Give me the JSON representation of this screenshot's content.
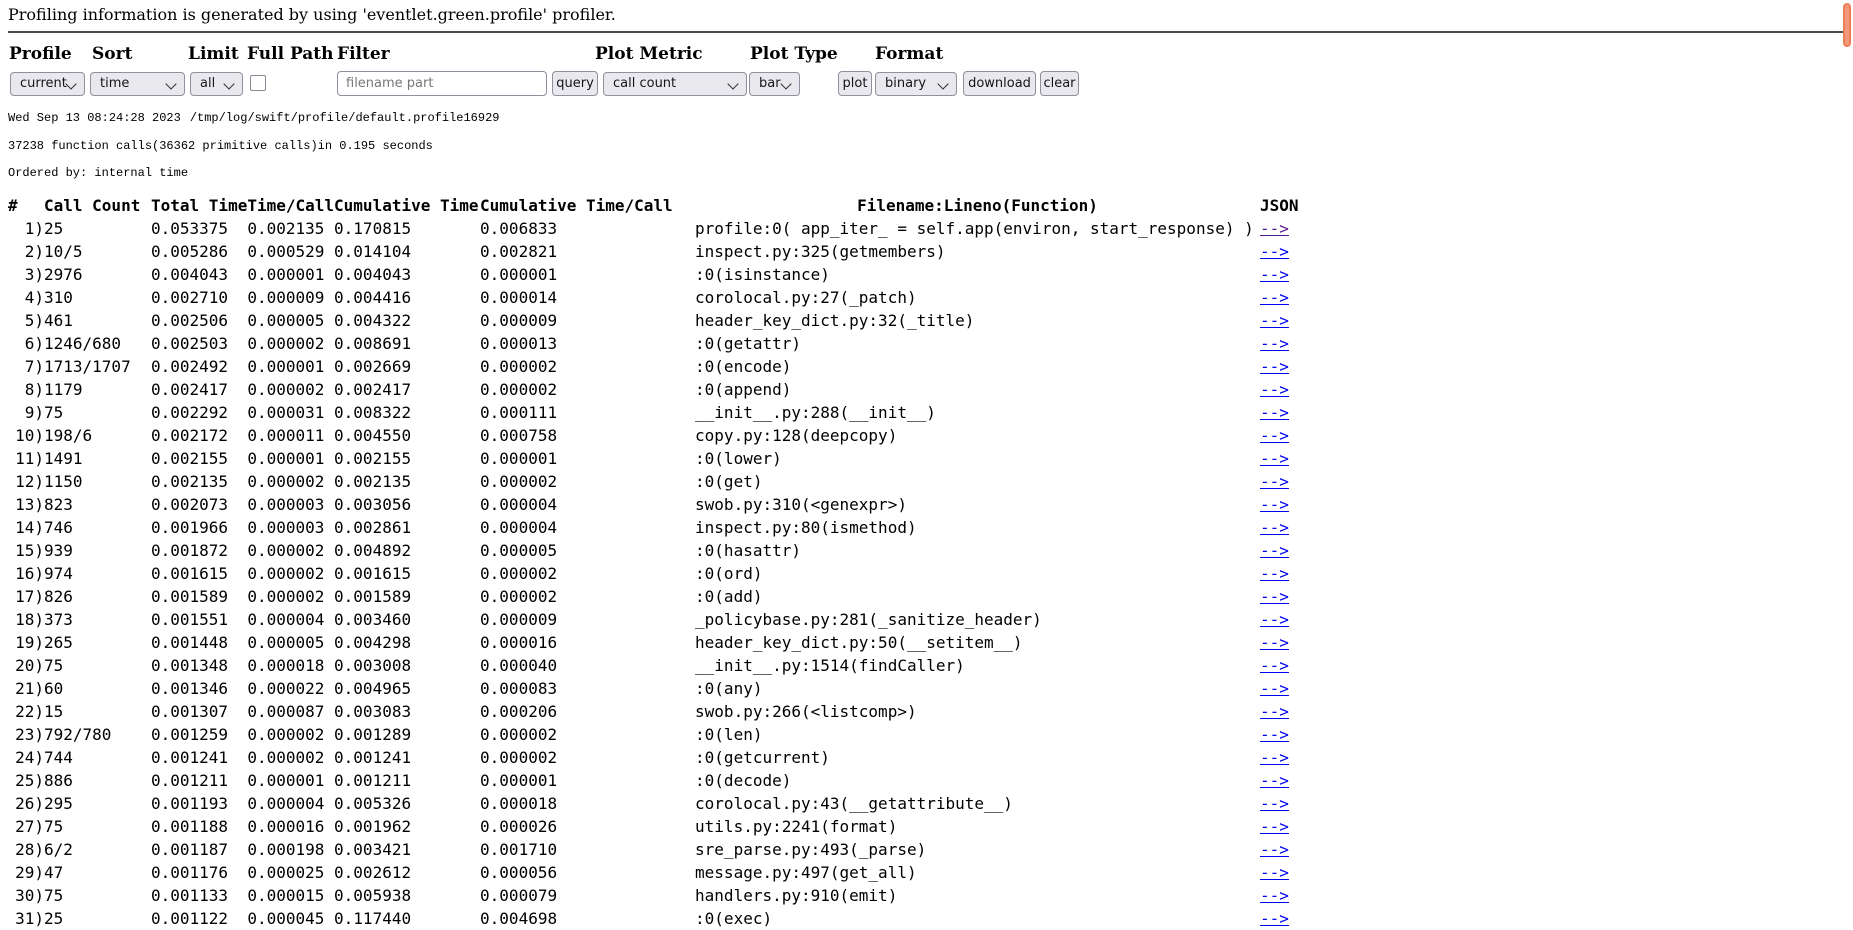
{
  "intro": "Profiling information is generated by using 'eventlet.green.profile' profiler.",
  "form": {
    "profile": {
      "label": "Profile",
      "value": "current"
    },
    "sort": {
      "label": "Sort",
      "value": "time"
    },
    "limit": {
      "label": "Limit",
      "value": "all"
    },
    "full_path": {
      "label": "Full Path",
      "checked": false
    },
    "filter": {
      "label": "Filter",
      "placeholder": "filename part",
      "value": ""
    },
    "plot_metric": {
      "label": "Plot Metric",
      "value": "call count"
    },
    "plot_type": {
      "label": "Plot Type",
      "value": "bar"
    },
    "format": {
      "label": "Format",
      "value": "binary"
    },
    "buttons": {
      "query": "query",
      "plot": "plot",
      "download": "download",
      "clear": "clear"
    }
  },
  "profile_info": {
    "timestamp": "Wed Sep 13 08:24:28 2023",
    "path": "/tmp/log/swift/profile/default.profile16929",
    "calls_summary": "37238 function calls(36362 primitive calls)in 0.195 seconds",
    "ordered_by": "Ordered by: internal time"
  },
  "table": {
    "headers": [
      "#",
      "Call Count",
      "Total Time",
      "Time/Call",
      "Cumulative Time",
      "Cumulative Time/Call",
      "Filename:Lineno(Function)",
      "JSON"
    ],
    "json_link_label": "-->",
    "rows": [
      {
        "n": "1)",
        "call_count": "25",
        "total_time": "0.053375",
        "time_per_call": "0.002135",
        "cum_time": "0.170815",
        "cum_time_per_call": "0.006833",
        "filename": "profile:0( app_iter_ = self.app(environ, start_response) )",
        "visited": true
      },
      {
        "n": "2)",
        "call_count": "10/5",
        "total_time": "0.005286",
        "time_per_call": "0.000529",
        "cum_time": "0.014104",
        "cum_time_per_call": "0.002821",
        "filename": "inspect.py:325(getmembers)",
        "visited": false
      },
      {
        "n": "3)",
        "call_count": "2976",
        "total_time": "0.004043",
        "time_per_call": "0.000001",
        "cum_time": "0.004043",
        "cum_time_per_call": "0.000001",
        "filename": ":0(isinstance)",
        "visited": false
      },
      {
        "n": "4)",
        "call_count": "310",
        "total_time": "0.002710",
        "time_per_call": "0.000009",
        "cum_time": "0.004416",
        "cum_time_per_call": "0.000014",
        "filename": "corolocal.py:27(_patch)",
        "visited": false
      },
      {
        "n": "5)",
        "call_count": "461",
        "total_time": "0.002506",
        "time_per_call": "0.000005",
        "cum_time": "0.004322",
        "cum_time_per_call": "0.000009",
        "filename": "header_key_dict.py:32(_title)",
        "visited": false
      },
      {
        "n": "6)",
        "call_count": "1246/680",
        "total_time": "0.002503",
        "time_per_call": "0.000002",
        "cum_time": "0.008691",
        "cum_time_per_call": "0.000013",
        "filename": ":0(getattr)",
        "visited": false
      },
      {
        "n": "7)",
        "call_count": "1713/1707",
        "total_time": "0.002492",
        "time_per_call": "0.000001",
        "cum_time": "0.002669",
        "cum_time_per_call": "0.000002",
        "filename": ":0(encode)",
        "visited": false
      },
      {
        "n": "8)",
        "call_count": "1179",
        "total_time": "0.002417",
        "time_per_call": "0.000002",
        "cum_time": "0.002417",
        "cum_time_per_call": "0.000002",
        "filename": ":0(append)",
        "visited": false
      },
      {
        "n": "9)",
        "call_count": "75",
        "total_time": "0.002292",
        "time_per_call": "0.000031",
        "cum_time": "0.008322",
        "cum_time_per_call": "0.000111",
        "filename": "__init__.py:288(__init__)",
        "visited": false
      },
      {
        "n": "10)",
        "call_count": "198/6",
        "total_time": "0.002172",
        "time_per_call": "0.000011",
        "cum_time": "0.004550",
        "cum_time_per_call": "0.000758",
        "filename": "copy.py:128(deepcopy)",
        "visited": false
      },
      {
        "n": "11)",
        "call_count": "1491",
        "total_time": "0.002155",
        "time_per_call": "0.000001",
        "cum_time": "0.002155",
        "cum_time_per_call": "0.000001",
        "filename": ":0(lower)",
        "visited": false
      },
      {
        "n": "12)",
        "call_count": "1150",
        "total_time": "0.002135",
        "time_per_call": "0.000002",
        "cum_time": "0.002135",
        "cum_time_per_call": "0.000002",
        "filename": ":0(get)",
        "visited": false
      },
      {
        "n": "13)",
        "call_count": "823",
        "total_time": "0.002073",
        "time_per_call": "0.000003",
        "cum_time": "0.003056",
        "cum_time_per_call": "0.000004",
        "filename": "swob.py:310(<genexpr>)",
        "visited": false
      },
      {
        "n": "14)",
        "call_count": "746",
        "total_time": "0.001966",
        "time_per_call": "0.000003",
        "cum_time": "0.002861",
        "cum_time_per_call": "0.000004",
        "filename": "inspect.py:80(ismethod)",
        "visited": false
      },
      {
        "n": "15)",
        "call_count": "939",
        "total_time": "0.001872",
        "time_per_call": "0.000002",
        "cum_time": "0.004892",
        "cum_time_per_call": "0.000005",
        "filename": ":0(hasattr)",
        "visited": false
      },
      {
        "n": "16)",
        "call_count": "974",
        "total_time": "0.001615",
        "time_per_call": "0.000002",
        "cum_time": "0.001615",
        "cum_time_per_call": "0.000002",
        "filename": ":0(ord)",
        "visited": false
      },
      {
        "n": "17)",
        "call_count": "826",
        "total_time": "0.001589",
        "time_per_call": "0.000002",
        "cum_time": "0.001589",
        "cum_time_per_call": "0.000002",
        "filename": ":0(add)",
        "visited": false
      },
      {
        "n": "18)",
        "call_count": "373",
        "total_time": "0.001551",
        "time_per_call": "0.000004",
        "cum_time": "0.003460",
        "cum_time_per_call": "0.000009",
        "filename": "_policybase.py:281(_sanitize_header)",
        "visited": false
      },
      {
        "n": "19)",
        "call_count": "265",
        "total_time": "0.001448",
        "time_per_call": "0.000005",
        "cum_time": "0.004298",
        "cum_time_per_call": "0.000016",
        "filename": "header_key_dict.py:50(__setitem__)",
        "visited": false
      },
      {
        "n": "20)",
        "call_count": "75",
        "total_time": "0.001348",
        "time_per_call": "0.000018",
        "cum_time": "0.003008",
        "cum_time_per_call": "0.000040",
        "filename": "__init__.py:1514(findCaller)",
        "visited": false
      },
      {
        "n": "21)",
        "call_count": "60",
        "total_time": "0.001346",
        "time_per_call": "0.000022",
        "cum_time": "0.004965",
        "cum_time_per_call": "0.000083",
        "filename": ":0(any)",
        "visited": false
      },
      {
        "n": "22)",
        "call_count": "15",
        "total_time": "0.001307",
        "time_per_call": "0.000087",
        "cum_time": "0.003083",
        "cum_time_per_call": "0.000206",
        "filename": "swob.py:266(<listcomp>)",
        "visited": false
      },
      {
        "n": "23)",
        "call_count": "792/780",
        "total_time": "0.001259",
        "time_per_call": "0.000002",
        "cum_time": "0.001289",
        "cum_time_per_call": "0.000002",
        "filename": ":0(len)",
        "visited": false
      },
      {
        "n": "24)",
        "call_count": "744",
        "total_time": "0.001241",
        "time_per_call": "0.000002",
        "cum_time": "0.001241",
        "cum_time_per_call": "0.000002",
        "filename": ":0(getcurrent)",
        "visited": false
      },
      {
        "n": "25)",
        "call_count": "886",
        "total_time": "0.001211",
        "time_per_call": "0.000001",
        "cum_time": "0.001211",
        "cum_time_per_call": "0.000001",
        "filename": ":0(decode)",
        "visited": false
      },
      {
        "n": "26)",
        "call_count": "295",
        "total_time": "0.001193",
        "time_per_call": "0.000004",
        "cum_time": "0.005326",
        "cum_time_per_call": "0.000018",
        "filename": "corolocal.py:43(__getattribute__)",
        "visited": false
      },
      {
        "n": "27)",
        "call_count": "75",
        "total_time": "0.001188",
        "time_per_call": "0.000016",
        "cum_time": "0.001962",
        "cum_time_per_call": "0.000026",
        "filename": "utils.py:2241(format)",
        "visited": false
      },
      {
        "n": "28)",
        "call_count": "6/2",
        "total_time": "0.001187",
        "time_per_call": "0.000198",
        "cum_time": "0.003421",
        "cum_time_per_call": "0.001710",
        "filename": "sre_parse.py:493(_parse)",
        "visited": false
      },
      {
        "n": "29)",
        "call_count": "47",
        "total_time": "0.001176",
        "time_per_call": "0.000025",
        "cum_time": "0.002612",
        "cum_time_per_call": "0.000056",
        "filename": "message.py:497(get_all)",
        "visited": false
      },
      {
        "n": "30)",
        "call_count": "75",
        "total_time": "0.001133",
        "time_per_call": "0.000015",
        "cum_time": "0.005938",
        "cum_time_per_call": "0.000079",
        "filename": "handlers.py:910(emit)",
        "visited": false
      },
      {
        "n": "31)",
        "call_count": "25",
        "total_time": "0.001122",
        "time_per_call": "0.000045",
        "cum_time": "0.117440",
        "cum_time_per_call": "0.004698",
        "filename": ":0(exec)",
        "visited": false
      }
    ]
  },
  "colors": {
    "link": "#0000ee",
    "visited_link": "#551a8b",
    "scrollbar_thumb": "#ef7e56",
    "control_background": "#e9e9ed",
    "control_border": "#8f8f9d",
    "rule": "#4a4a4a"
  }
}
